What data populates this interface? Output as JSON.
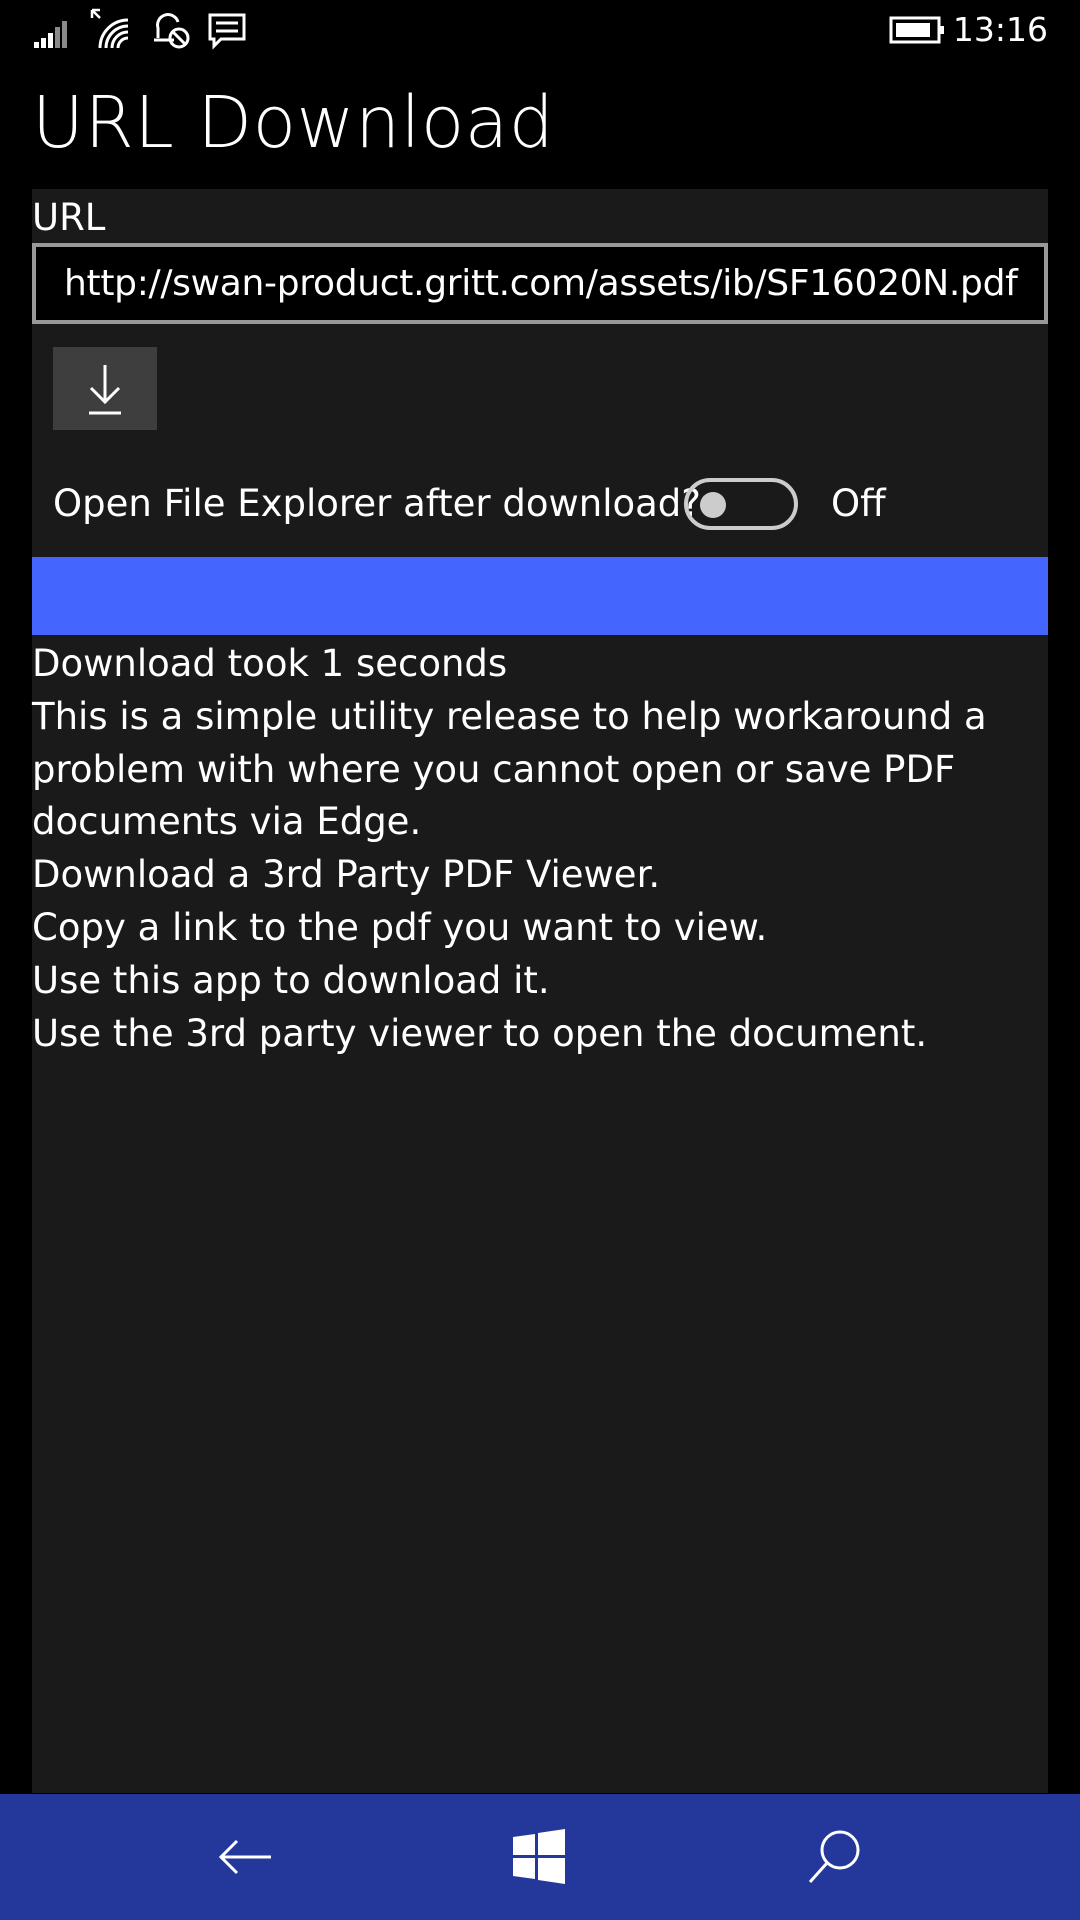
{
  "status_bar": {
    "time": "13:16",
    "icons": [
      "signal-icon",
      "wifi-icon",
      "quiet-hours-icon",
      "message-icon",
      "battery-icon"
    ]
  },
  "app": {
    "title": "URL Download"
  },
  "form": {
    "url_label": "URL",
    "url_value": "http://swan-product.gritt.com/assets/ib/SF16020N.pdf",
    "download_icon": "download-icon",
    "toggle_label": "Open File Explorer after download?",
    "toggle_on": false,
    "toggle_state_text": "Off"
  },
  "progress": {
    "fraction": 1.0,
    "color": "#4466ff"
  },
  "info": {
    "lines": [
      "Download took 1 seconds",
      "This is a simple utility release to help workaround a",
      "problem with where you cannot open or save PDF",
      "documents via Edge.",
      "Download a 3rd Party PDF Viewer.",
      "Copy a link to the pdf you want to view.",
      "Use this app to download it.",
      "Use the 3rd party viewer to open the document."
    ]
  },
  "nav_bar": {
    "color": "#23389a",
    "buttons": [
      "back-arrow-icon",
      "windows-start-icon",
      "search-icon"
    ]
  }
}
